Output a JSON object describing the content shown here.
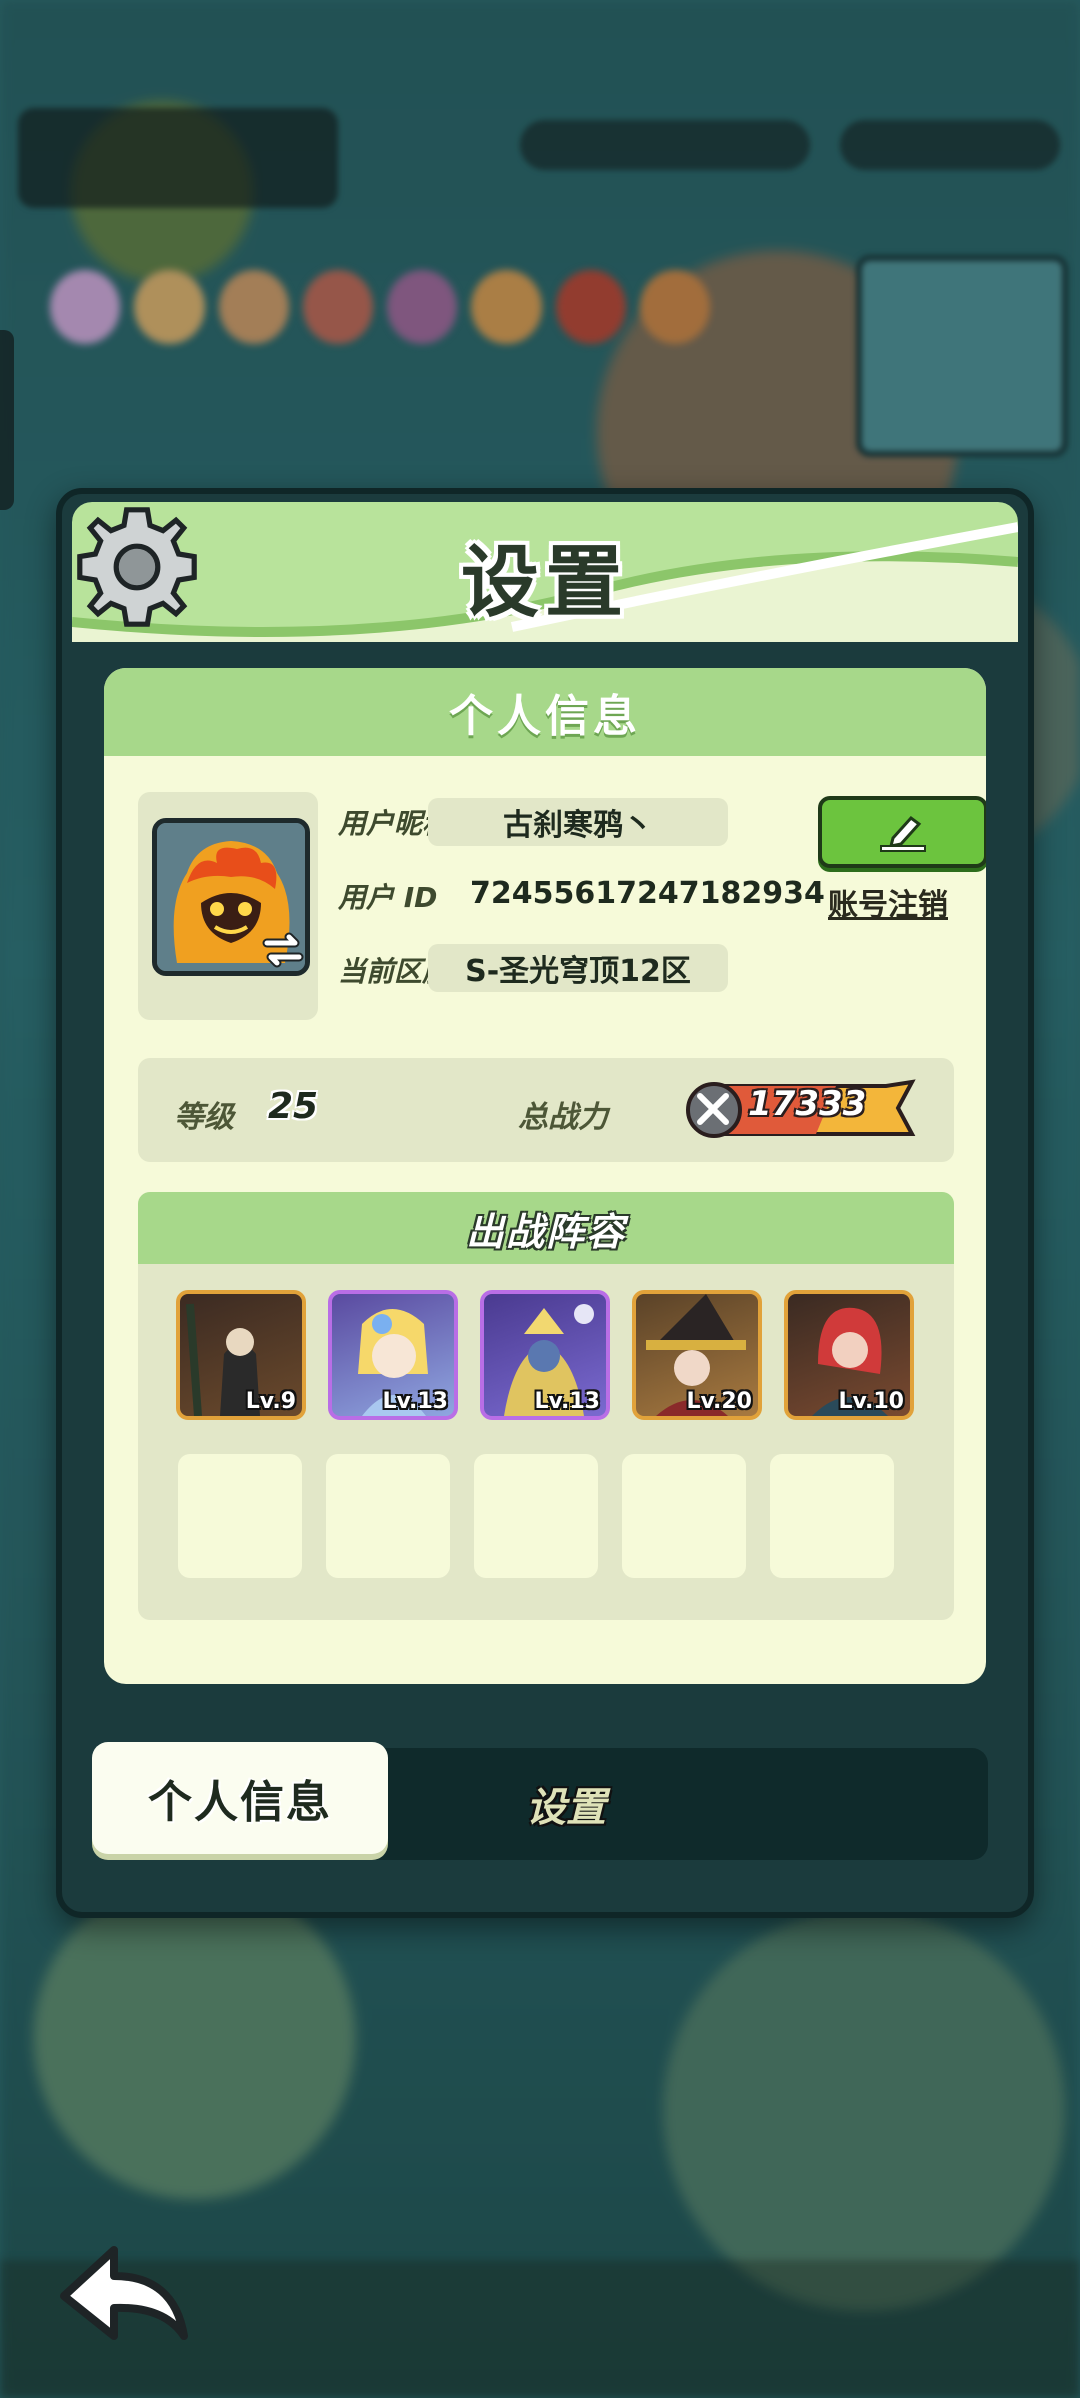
{
  "modal": {
    "title": "设置"
  },
  "info": {
    "section_title": "个人信息",
    "nickname_label": "用户昵称",
    "nickname": "古刹寒鸦丶",
    "id_label": "用户  ID",
    "id_value": "72455617247182934",
    "cancel_account": "账号注销",
    "server_label": "当前区服",
    "server": "S-圣光穹顶12区"
  },
  "stats": {
    "level_label": "等级",
    "level": "25",
    "power_label": "总战力",
    "power": "17333"
  },
  "lineup": {
    "title": "出战阵容",
    "heroes": [
      {
        "level": "Lv.9",
        "rarity": "legendary"
      },
      {
        "level": "Lv.13",
        "rarity": "epic"
      },
      {
        "level": "Lv.13",
        "rarity": "epic"
      },
      {
        "level": "Lv.20",
        "rarity": "legendary"
      },
      {
        "level": "Lv.10",
        "rarity": "legendary"
      }
    ]
  },
  "tabs": {
    "active": "个人信息",
    "inactive": "设置"
  },
  "colors": {
    "accent_green": "#a7d88a",
    "panel": "#f6fad9",
    "button_green": "#6cc43e"
  }
}
